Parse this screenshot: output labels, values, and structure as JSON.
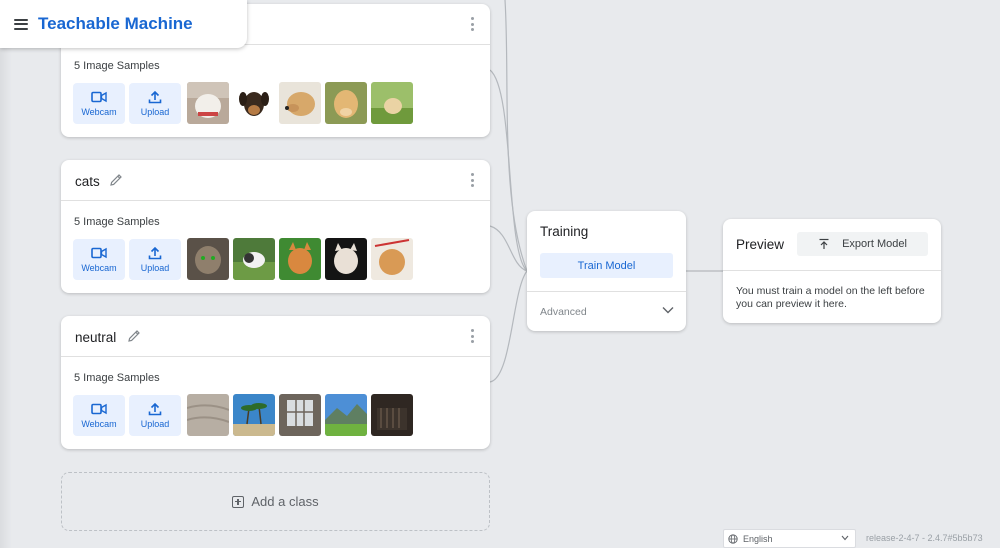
{
  "header": {
    "app_title": "Teachable Machine",
    "menu_icon": "hamburger-menu-icon"
  },
  "classes": [
    {
      "name": "",
      "samples_label": "5 Image Samples",
      "webcam_label": "Webcam",
      "upload_label": "Upload",
      "thumbnails": [
        "dog-white-collar",
        "puppy-rottweiler",
        "yellow-lab",
        "golden-retriever",
        "puppy-on-grass"
      ]
    },
    {
      "name": "cats",
      "samples_label": "5 Image Samples",
      "webcam_label": "Webcam",
      "upload_label": "Upload",
      "thumbnails": [
        "tabby-cat",
        "cat-on-grass",
        "orange-cat-green",
        "white-cat-black",
        "orange-cat-leash"
      ]
    },
    {
      "name": "neutral",
      "samples_label": "5 Image Samples",
      "webcam_label": "Webcam",
      "upload_label": "Upload",
      "thumbnails": [
        "fabric-surface",
        "palm-trees-sky",
        "window-room",
        "mountain-meadow",
        "dark-closet"
      ]
    }
  ],
  "add_class": {
    "label": "Add a class"
  },
  "training": {
    "title": "Training",
    "train_button": "Train Model",
    "advanced_label": "Advanced"
  },
  "preview": {
    "title": "Preview",
    "export_button": "Export Model",
    "message": "You must train a model on the left before you can preview it here."
  },
  "footer": {
    "language": "English",
    "release": "release-2-4-7 - 2.4.7#5b5b73"
  },
  "colors": {
    "accent": "#1967d2",
    "button_bg": "#e8f0fe",
    "background": "#e8eaed"
  }
}
